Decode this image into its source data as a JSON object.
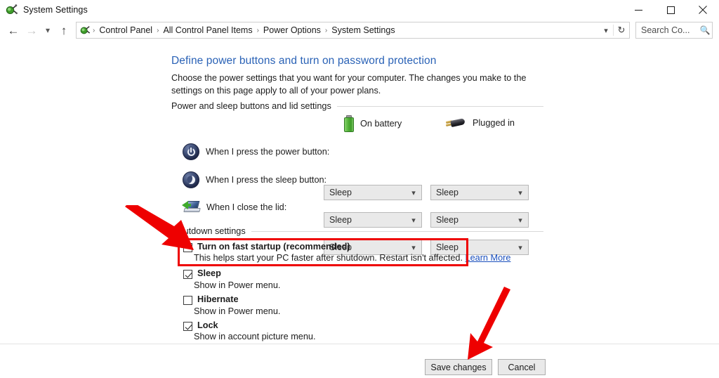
{
  "window": {
    "title": "System Settings",
    "icon": "power-settings-icon",
    "controls": {
      "minimize": "minimize-icon",
      "maximize": "maximize-icon",
      "close": "close-icon"
    }
  },
  "nav": {
    "back": "back-arrow-icon",
    "forward": "forward-arrow-icon",
    "recent": "chevron-down-icon",
    "up": "up-arrow-icon",
    "breadcrumb": [
      "Control Panel",
      "All Control Panel Items",
      "Power Options",
      "System Settings"
    ],
    "separator": "›",
    "address_dropdown": "chevron-down-icon",
    "refresh": "refresh-icon",
    "search": {
      "placeholder": "Search Co...",
      "icon": "search-icon"
    }
  },
  "page": {
    "heading": "Define power buttons and turn on password protection",
    "description": "Choose the power settings that you want for your computer. The changes you make to the settings on this page apply to all of your power plans."
  },
  "sections": {
    "power_sleep": {
      "title": "Power and sleep buttons and lid settings",
      "columns": [
        {
          "label": "On battery",
          "icon": "battery-icon"
        },
        {
          "label": "Plugged in",
          "icon": "power-plug-icon"
        }
      ],
      "rows": [
        {
          "icon": "power-button-icon",
          "label": "When I press the power button:",
          "on_battery": "Sleep",
          "plugged_in": "Sleep"
        },
        {
          "icon": "sleep-button-icon",
          "label": "When I press the sleep button:",
          "on_battery": "Sleep",
          "plugged_in": "Sleep"
        },
        {
          "icon": "laptop-lid-icon",
          "label": "When I close the lid:",
          "on_battery": "Sleep",
          "plugged_in": "Sleep"
        }
      ]
    },
    "shutdown": {
      "title": "Shutdown settings",
      "options": [
        {
          "label": "Turn on fast startup (recommended)",
          "checked": false,
          "description": "This helps start your PC faster after shutdown. Restart isn't affected.",
          "link": "Learn More",
          "highlighted": true
        },
        {
          "label": "Sleep",
          "checked": true,
          "description": "Show in Power menu."
        },
        {
          "label": "Hibernate",
          "checked": false,
          "description": "Show in Power menu."
        },
        {
          "label": "Lock",
          "checked": true,
          "description": "Show in account picture menu."
        }
      ]
    }
  },
  "footer": {
    "save": "Save changes",
    "cancel": "Cancel"
  },
  "annotations": {
    "highlight_color": "#ee0000",
    "arrows": [
      {
        "name": "arrow-to-fast-startup",
        "direction": "down-right"
      },
      {
        "name": "arrow-to-save-changes",
        "direction": "down-left"
      }
    ]
  },
  "colors": {
    "heading": "#2a62b6",
    "link": "#1a4fbd",
    "annotation": "#ee0000"
  }
}
